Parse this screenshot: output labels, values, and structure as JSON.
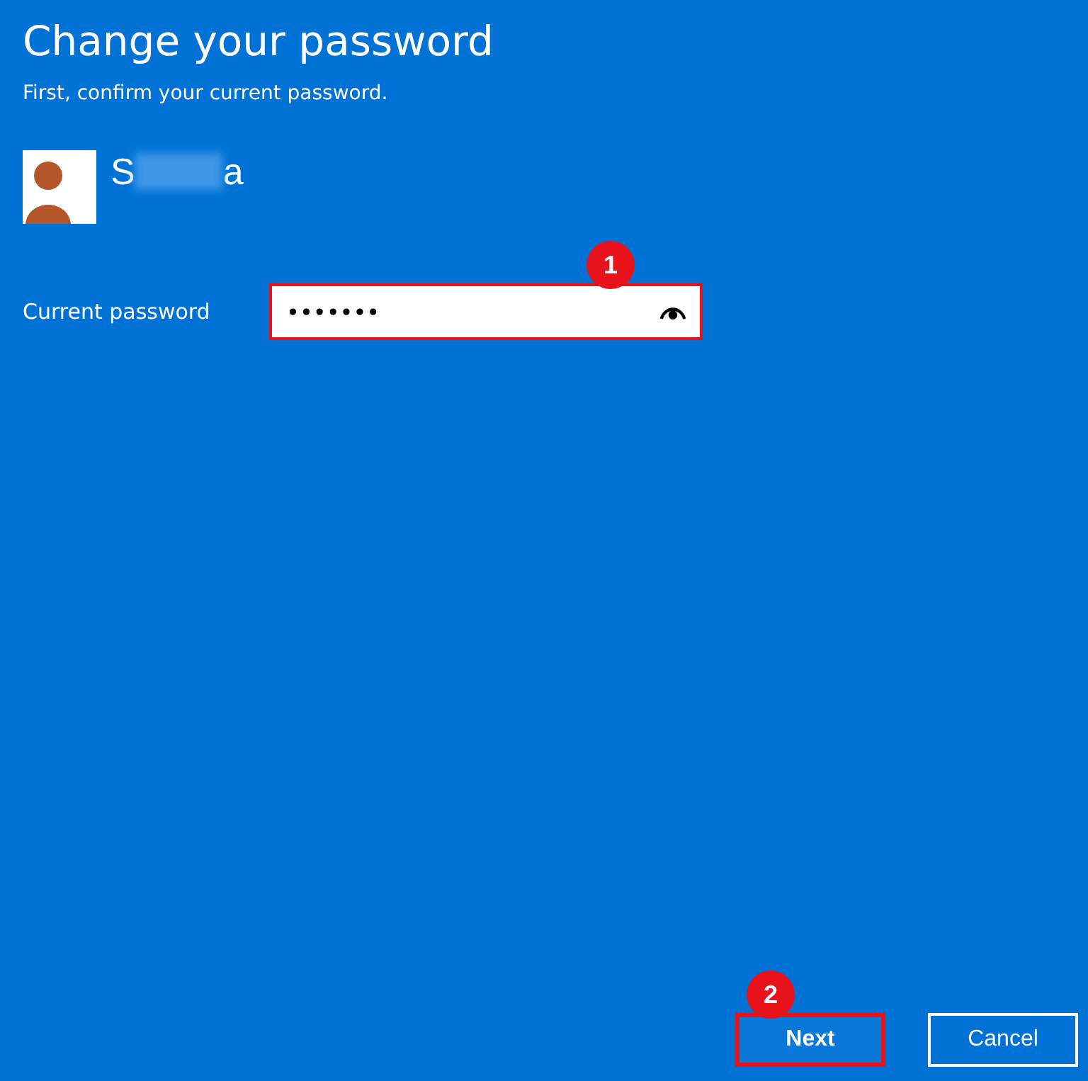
{
  "title": "Change your password",
  "subtitle": "First, confirm your current password.",
  "account": {
    "name_start": "S",
    "name_end": "a",
    "redacted": true
  },
  "password_field": {
    "label": "Current password",
    "value": "•••••••",
    "highlighted": true,
    "callout": "1"
  },
  "buttons": [
    {
      "label": "Next",
      "kind": "primary",
      "highlighted": true,
      "callout": "2"
    },
    {
      "label": "Cancel",
      "kind": "secondary",
      "highlighted": false
    }
  ]
}
